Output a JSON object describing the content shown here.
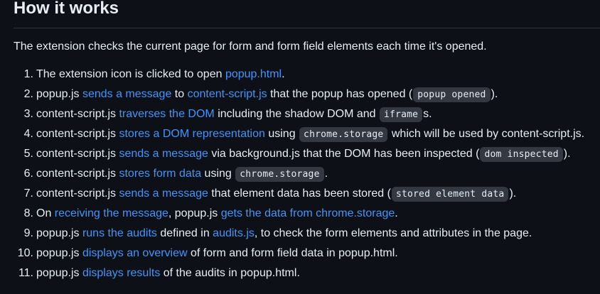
{
  "heading": "How it works",
  "intro": "The extension checks the current page for form and form field elements each time it's opened.",
  "steps": [
    {
      "number": "1.",
      "parts": [
        {
          "t": "text",
          "v": "The extension icon is clicked to open "
        },
        {
          "t": "link",
          "v": "popup.html"
        },
        {
          "t": "text",
          "v": "."
        }
      ]
    },
    {
      "number": "2.",
      "parts": [
        {
          "t": "text",
          "v": "popup.js "
        },
        {
          "t": "link",
          "v": "sends a message"
        },
        {
          "t": "text",
          "v": " to "
        },
        {
          "t": "link",
          "v": "content-script.js"
        },
        {
          "t": "text",
          "v": " that the popup has opened ("
        },
        {
          "t": "code",
          "v": "popup opened"
        },
        {
          "t": "text",
          "v": ")."
        }
      ]
    },
    {
      "number": "3.",
      "parts": [
        {
          "t": "text",
          "v": "content-script.js "
        },
        {
          "t": "link",
          "v": "traverses the DOM"
        },
        {
          "t": "text",
          "v": " including the shadow DOM and "
        },
        {
          "t": "code",
          "v": "iframe"
        },
        {
          "t": "text",
          "v": "s."
        }
      ]
    },
    {
      "number": "4.",
      "parts": [
        {
          "t": "text",
          "v": "content-script.js "
        },
        {
          "t": "link",
          "v": "stores a DOM representation"
        },
        {
          "t": "text",
          "v": " using "
        },
        {
          "t": "code",
          "v": "chrome.storage"
        },
        {
          "t": "text",
          "v": " which will be used by content-script.js."
        }
      ]
    },
    {
      "number": "5.",
      "parts": [
        {
          "t": "text",
          "v": "content-script.js "
        },
        {
          "t": "link",
          "v": "sends a message"
        },
        {
          "t": "text",
          "v": " via background.js that the DOM has been inspected ("
        },
        {
          "t": "code",
          "v": "dom inspected"
        },
        {
          "t": "text",
          "v": ")."
        }
      ]
    },
    {
      "number": "6.",
      "parts": [
        {
          "t": "text",
          "v": "content-script.js "
        },
        {
          "t": "link",
          "v": "stores form data"
        },
        {
          "t": "text",
          "v": " using "
        },
        {
          "t": "code",
          "v": "chrome.storage"
        },
        {
          "t": "text",
          "v": "."
        }
      ]
    },
    {
      "number": "7.",
      "parts": [
        {
          "t": "text",
          "v": "content-script.js "
        },
        {
          "t": "link",
          "v": "sends a message"
        },
        {
          "t": "text",
          "v": " that element data has been stored ("
        },
        {
          "t": "code",
          "v": "stored element data"
        },
        {
          "t": "text",
          "v": ")."
        }
      ]
    },
    {
      "number": "8.",
      "parts": [
        {
          "t": "text",
          "v": "On "
        },
        {
          "t": "link",
          "v": "receiving the message"
        },
        {
          "t": "text",
          "v": ", popup.js "
        },
        {
          "t": "link",
          "v": "gets the data from chrome.storage"
        },
        {
          "t": "text",
          "v": "."
        }
      ]
    },
    {
      "number": "9.",
      "parts": [
        {
          "t": "text",
          "v": "popup.js "
        },
        {
          "t": "link",
          "v": "runs the audits"
        },
        {
          "t": "text",
          "v": " defined in "
        },
        {
          "t": "link",
          "v": "audits.js"
        },
        {
          "t": "text",
          "v": ", to check the form elements and attributes in the page."
        }
      ]
    },
    {
      "number": "10.",
      "parts": [
        {
          "t": "text",
          "v": "popup.js "
        },
        {
          "t": "link",
          "v": "displays an overview"
        },
        {
          "t": "text",
          "v": " of form and form field data in popup.html."
        }
      ]
    },
    {
      "number": "11.",
      "parts": [
        {
          "t": "text",
          "v": "popup.js "
        },
        {
          "t": "link",
          "v": "displays results"
        },
        {
          "t": "text",
          "v": " of the audits in popup.html."
        }
      ]
    }
  ]
}
